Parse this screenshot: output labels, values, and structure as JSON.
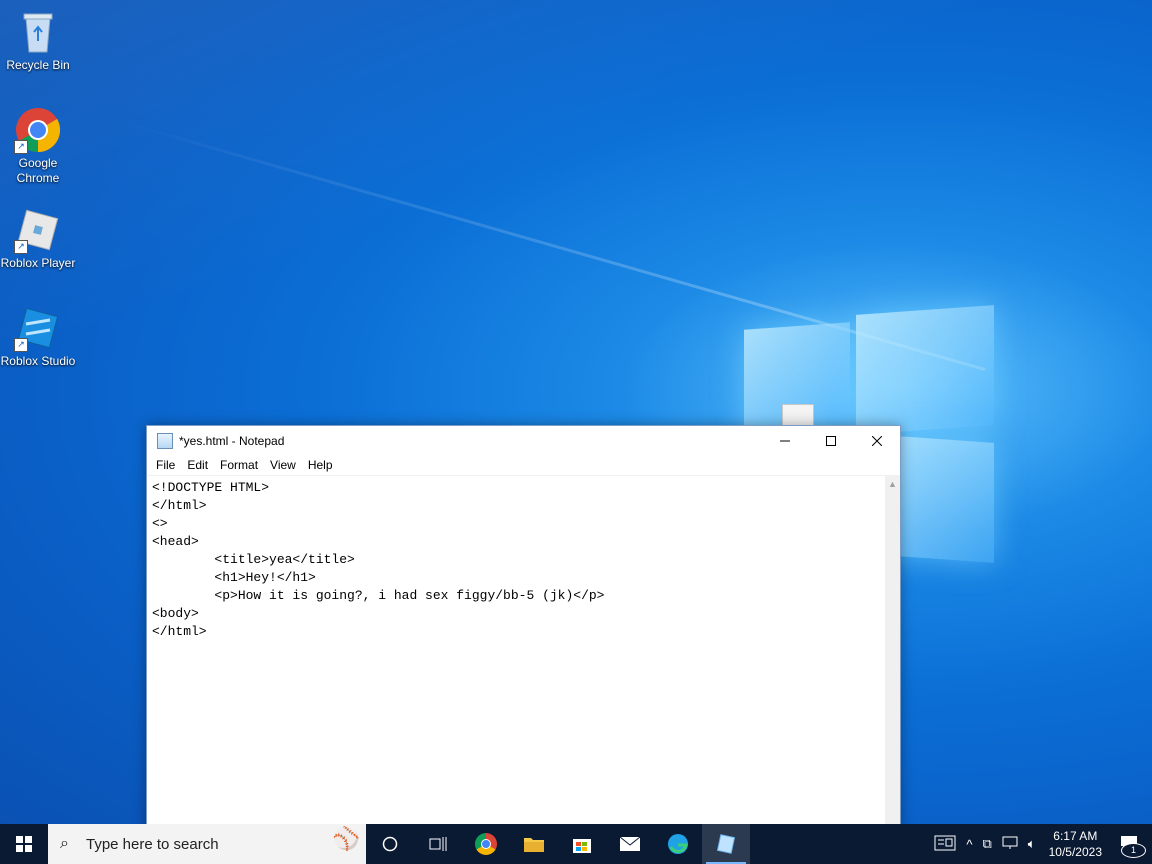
{
  "desktop": {
    "icons": [
      {
        "label": "Recycle Bin"
      },
      {
        "label": "Google Chrome"
      },
      {
        "label": "Roblox Player"
      },
      {
        "label": "Roblox Studio"
      }
    ]
  },
  "notepad": {
    "title": "*yes.html - Notepad",
    "menu": [
      "File",
      "Edit",
      "Format",
      "View",
      "Help"
    ],
    "content": "<!DOCTYPE HTML>\n</html>\n<>\n<head>\n        <title>yea</title>\n        <h1>Hey!</h1>\n        <p>How it is going?, i had sex figgy/bb-5 (jk)</p>\n<body>\n</html>",
    "minimize_icon": "minimize-icon",
    "maximize_icon": "maximize-icon",
    "close_icon": "close-icon"
  },
  "taskbar": {
    "search_placeholder": "Type here to search",
    "apps": [
      "cortana",
      "task-view",
      "google-chrome",
      "file-explorer",
      "microsoft-store",
      "mail",
      "microsoft-edge",
      "notepad"
    ],
    "time": "6:17 AM",
    "date": "10/5/2023",
    "notification_count": "1"
  },
  "colors": {
    "taskbar": "#0a1a33",
    "desktop_accent": "#0b6fd6"
  }
}
